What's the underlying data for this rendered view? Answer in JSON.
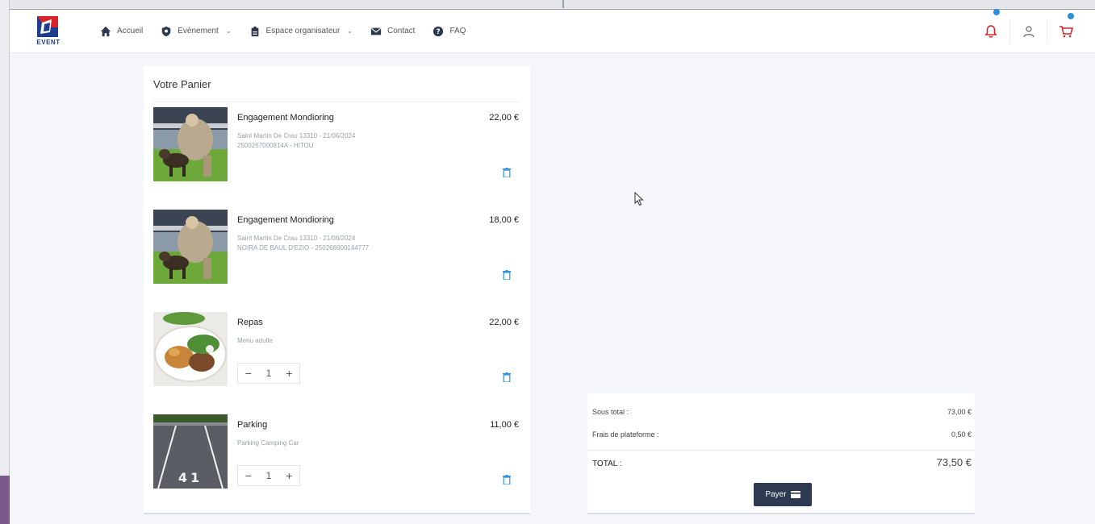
{
  "brand": {
    "logo_text": "EVENT",
    "colors": {
      "red": "#d8232a",
      "blue": "#1d3d8f",
      "accent": "#2b8fe0",
      "dark": "#2c3950"
    }
  },
  "nav": {
    "items": [
      {
        "label": "Accueil",
        "icon": "home-icon",
        "dropdown": false
      },
      {
        "label": "Evènement",
        "icon": "shield-icon",
        "dropdown": true
      },
      {
        "label": "Espace organisateur",
        "icon": "badge-icon",
        "dropdown": true
      },
      {
        "label": "Contact",
        "icon": "mail-icon",
        "dropdown": false
      },
      {
        "label": "FAQ",
        "icon": "help-icon",
        "dropdown": false
      }
    ],
    "right_icons": [
      "bell-icon",
      "user-icon",
      "cart-icon"
    ]
  },
  "cart": {
    "title": "Votre Panier",
    "items": [
      {
        "name": "Engagement Mondioring",
        "price": "22,00 €",
        "desc1": "Saint Martin De Crau 13310 - 21/06/2024",
        "desc2": "2500267000814A - HITOU",
        "image": "dog-training-photo",
        "stepper": false
      },
      {
        "name": "Engagement Mondioring",
        "price": "18,00 €",
        "desc1": "Saint Martin De Crau 13310 - 21/06/2024",
        "desc2": "NOIRA DE BAUL D'EZIO - 250268600144777",
        "image": "dog-training-photo",
        "stepper": false
      },
      {
        "name": "Repas",
        "price": "22,00 €",
        "desc1": "Menu adulte",
        "desc2": "",
        "image": "meal-photo",
        "stepper": true,
        "qty": "1"
      },
      {
        "name": "Parking",
        "price": "11,00 €",
        "desc1": "Parking Camping Car",
        "desc2": "",
        "image": "parking-photo",
        "stepper": true,
        "qty": "1"
      }
    ]
  },
  "summary": {
    "subtotal_label": "Sous total :",
    "subtotal_value": "73,00 €",
    "fees_label": "Frais de plateforme :",
    "fees_value": "0,50 €",
    "total_label": "TOTAL :",
    "total_value": "73,50 €",
    "pay_label": "Payer"
  }
}
